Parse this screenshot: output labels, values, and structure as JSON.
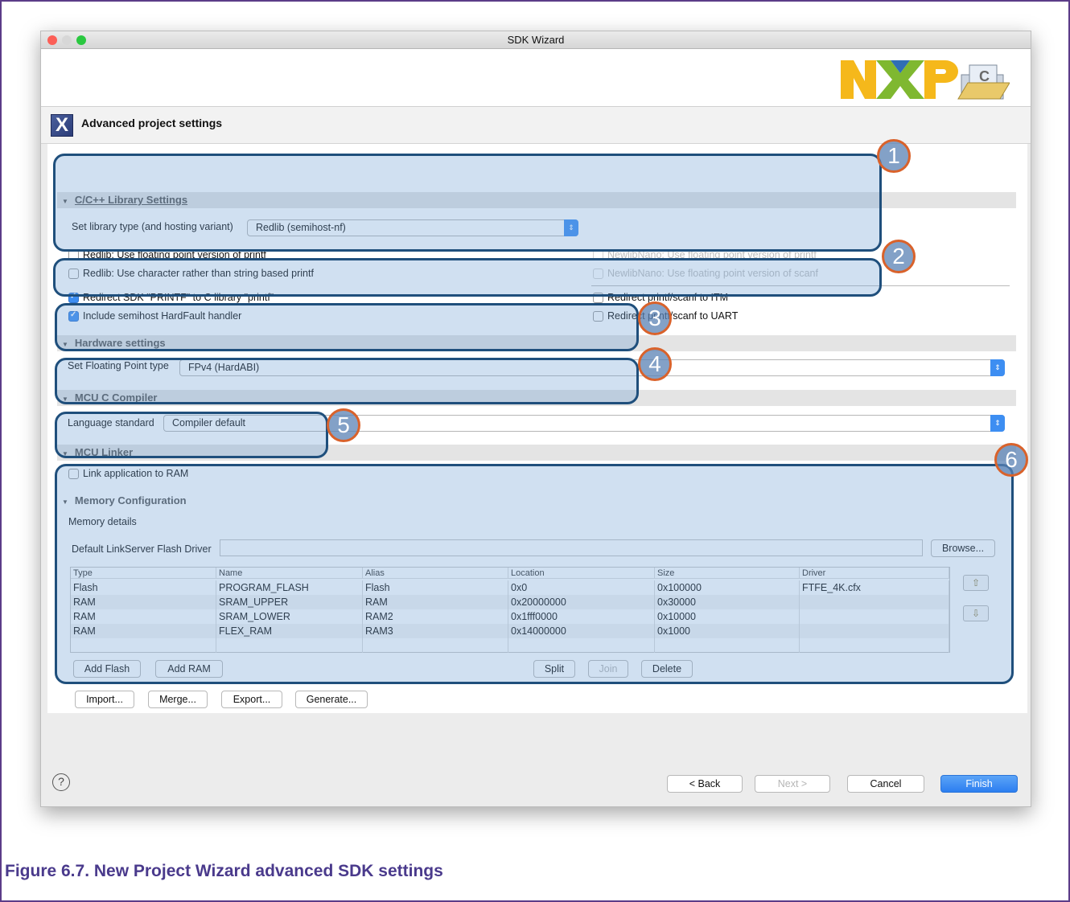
{
  "window": {
    "title": "SDK Wizard"
  },
  "header": {
    "title": "Advanced project settings",
    "logo_text": "NXP"
  },
  "library": {
    "section": "C/C++ Library Settings",
    "type_label": "Set library type (and hosting variant)",
    "type_value": "Redlib (semihost-nf)",
    "cb_float_printf": "Redlib: Use floating point version of printf",
    "cb_char_printf": "Redlib: Use character rather than string based printf",
    "cb_nano_printf": "NewlibNano: Use floating point version of printf",
    "cb_nano_scanf": "NewlibNano: Use floating point version of scanf"
  },
  "redirect": {
    "cb_sdk_printf": "Redirect SDK \"PRINTF\" to C library \"printf\"",
    "cb_hardfault": "Include semihost HardFault handler",
    "cb_itm": "Redirect printf/scanf to ITM",
    "cb_uart": "Redirect printf/scanf to UART"
  },
  "hardware": {
    "section": "Hardware settings",
    "fp_label": "Set Floating Point type",
    "fp_value": "FPv4 (HardABI)"
  },
  "compiler": {
    "section": "MCU C Compiler",
    "lang_label": "Language standard",
    "lang_value": "Compiler default"
  },
  "linker": {
    "section": "MCU Linker",
    "cb_ram": "Link application to RAM"
  },
  "memory": {
    "section": "Memory Configuration",
    "details": "Memory details",
    "flash_driver_label": "Default LinkServer Flash Driver",
    "flash_driver_value": "",
    "browse": "Browse...",
    "columns": [
      "Type",
      "Name",
      "Alias",
      "Location",
      "Size",
      "Driver"
    ],
    "rows": [
      [
        "Flash",
        "PROGRAM_FLASH",
        "Flash",
        "0x0",
        "0x100000",
        "FTFE_4K.cfx"
      ],
      [
        "RAM",
        "SRAM_UPPER",
        "RAM",
        "0x20000000",
        "0x30000",
        ""
      ],
      [
        "RAM",
        "SRAM_LOWER",
        "RAM2",
        "0x1fff0000",
        "0x10000",
        ""
      ],
      [
        "RAM",
        "FLEX_RAM",
        "RAM3",
        "0x14000000",
        "0x1000",
        ""
      ]
    ],
    "add_flash": "Add Flash",
    "add_ram": "Add RAM",
    "split": "Split",
    "join": "Join",
    "delete": "Delete",
    "import": "Import...",
    "merge": "Merge...",
    "export": "Export...",
    "generate": "Generate..."
  },
  "badges": [
    "1",
    "2",
    "3",
    "4",
    "5",
    "6"
  ],
  "footer": {
    "help": "?",
    "back": "< Back",
    "next": "Next >",
    "cancel": "Cancel",
    "finish": "Finish"
  },
  "caption": "Figure 6.7. New Project Wizard advanced SDK settings"
}
